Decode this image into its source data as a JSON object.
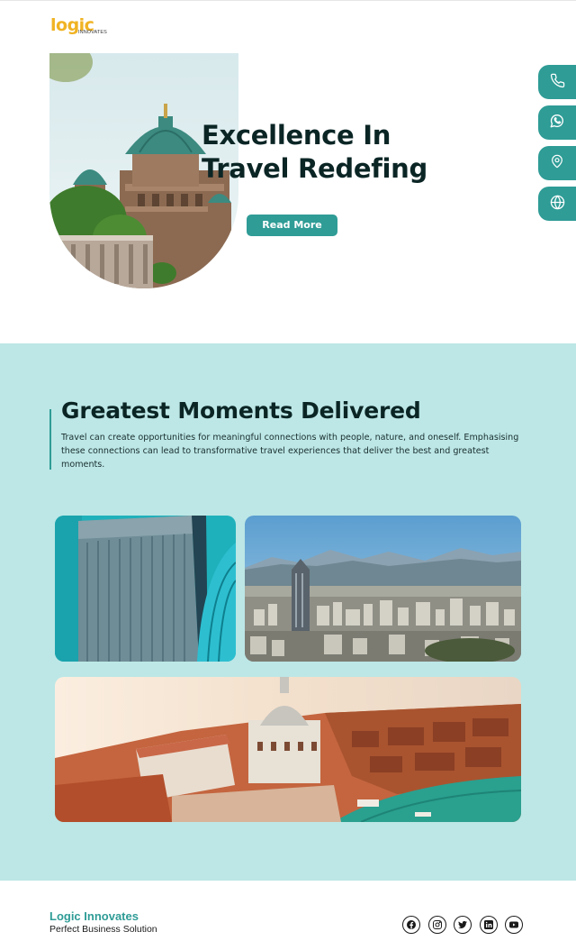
{
  "brand": {
    "logo_word": "logic",
    "logo_sub": "INNOVATES"
  },
  "hero": {
    "title_line1": "Excellence In",
    "title_line2": "Travel Redefing",
    "button_label": "Read More"
  },
  "side_contact": [
    {
      "icon": "phone-icon"
    },
    {
      "icon": "whatsapp-icon"
    },
    {
      "icon": "location-pin-icon"
    },
    {
      "icon": "globe-icon"
    }
  ],
  "moments": {
    "title": "Greatest Moments Delivered",
    "text": "Travel can create opportunities for meaningful connections with people, nature, and oneself. Emphasising these connections can lead to transformative travel experiences that deliver the best and greatest moments."
  },
  "footer": {
    "company": "Logic Innovates",
    "tagline": "Perfect Business Solution",
    "socials": [
      "facebook-icon",
      "instagram-icon",
      "twitter-icon",
      "linkedin-icon",
      "youtube-icon"
    ]
  },
  "colors": {
    "accent": "#2f9c96",
    "band": "#bce7e6",
    "logo": "#f0b323",
    "heading": "#0b2525"
  }
}
